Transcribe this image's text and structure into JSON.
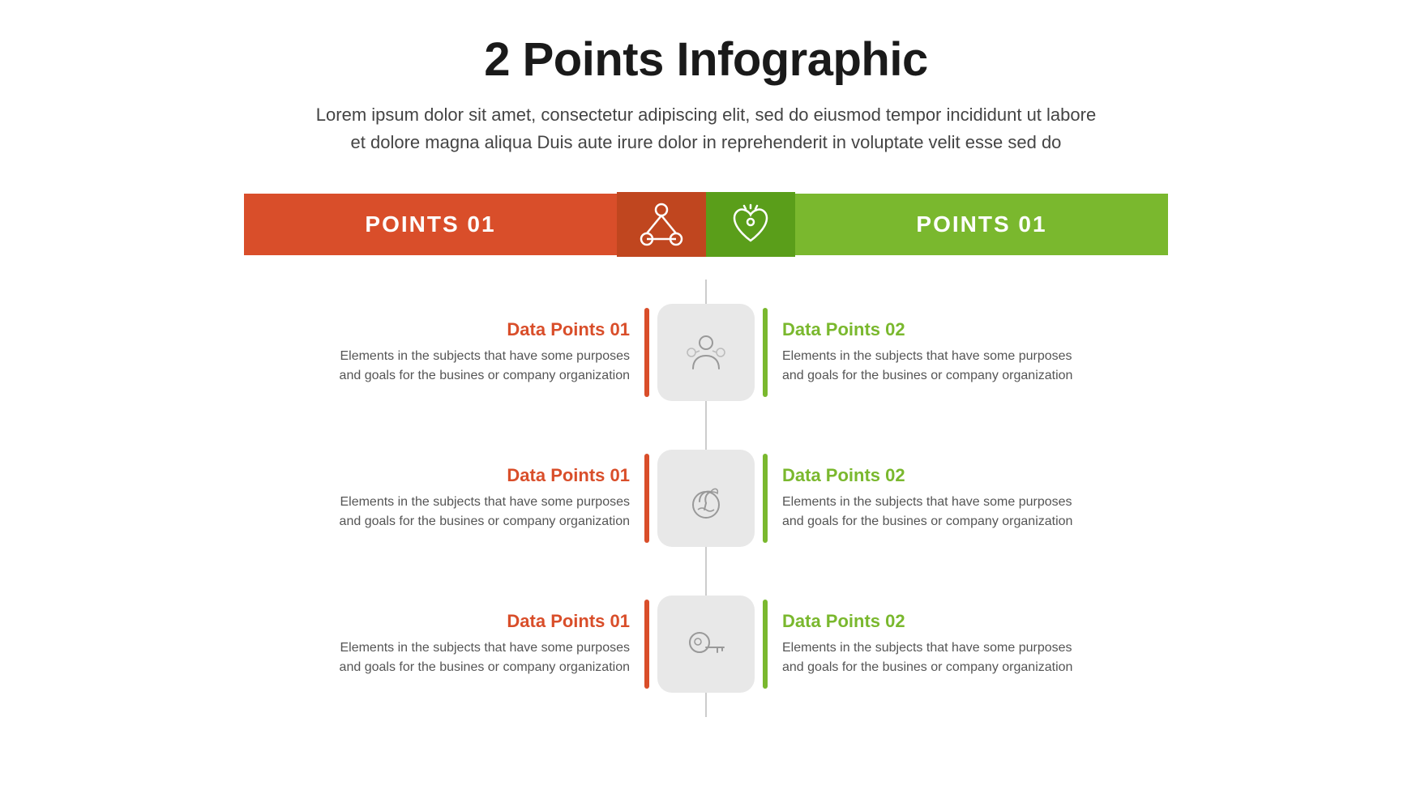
{
  "title": "2 Points Infographic",
  "subtitle_line1": "Lorem ipsum dolor sit amet, consectetur adipiscing elit, sed do eiusmod tempor incididunt ut labore",
  "subtitle_line2": "et dolore magna aliqua Duis aute irure dolor in reprehenderit in voluptate velit esse sed do",
  "header": {
    "left_label": "POINTS 01",
    "right_label": "POINTS 01"
  },
  "rows": [
    {
      "left_title": "Data Points 01",
      "left_desc_line1": "Elements in the subjects that have some purposes",
      "left_desc_line2": "and goals for the  busines or company organization",
      "right_title": "Data Points 02",
      "right_desc_line1": "Elements in the subjects that have some purposes",
      "right_desc_line2": "and goals for the  busines or company organization"
    },
    {
      "left_title": "Data Points 01",
      "left_desc_line1": "Elements in the subjects that have some purposes",
      "left_desc_line2": "and goals for the  busines or company organization",
      "right_title": "Data Points 02",
      "right_desc_line1": "Elements in the subjects that have some purposes",
      "right_desc_line2": "and goals for the  busines or company organization"
    },
    {
      "left_title": "Data Points 01",
      "left_desc_line1": "Elements in the subjects that have some purposes",
      "left_desc_line2": "and goals for the  busines or company organization",
      "right_title": "Data Points 02",
      "right_desc_line1": "Elements in the subjects that have some purposes",
      "right_desc_line2": "and goals for the  busines or company organization"
    }
  ],
  "colors": {
    "orange": "#d94e2a",
    "orange_dark": "#c0461f",
    "green": "#7ab82e",
    "green_dark": "#5a9e1a"
  }
}
